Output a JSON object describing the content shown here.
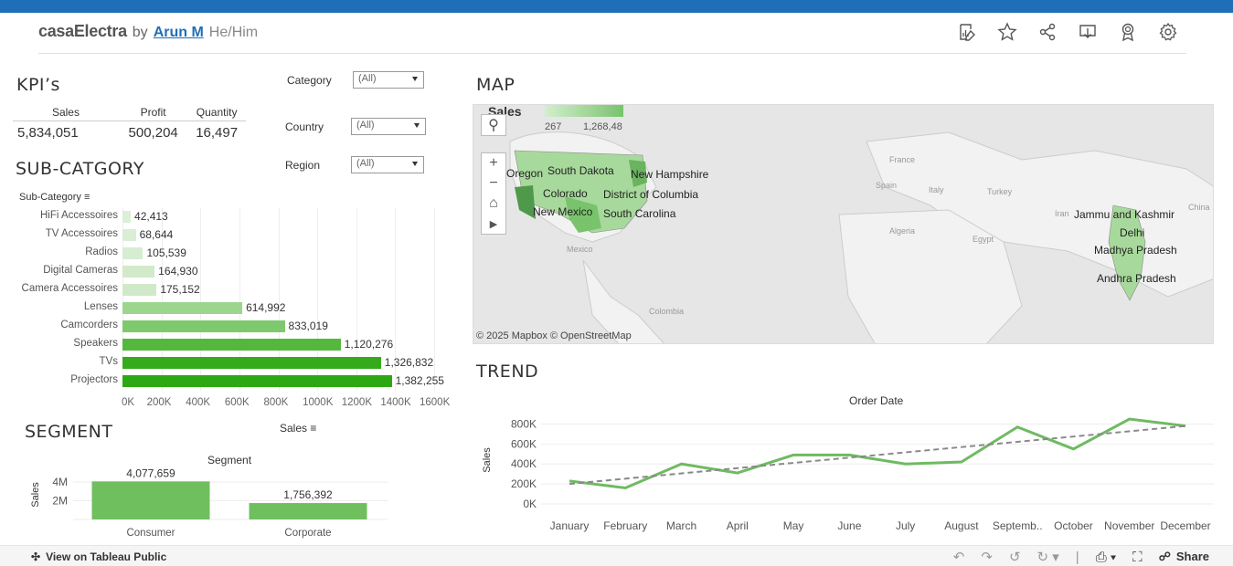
{
  "header": {
    "brand": "casaElectra",
    "by": "by",
    "author": "Arun M",
    "pronouns": "He/Him",
    "icons": [
      "edit-icon",
      "star-icon",
      "share-icon",
      "download-icon",
      "award-icon",
      "settings-icon"
    ]
  },
  "kpi": {
    "title": "KPI’s",
    "headers": [
      "Sales",
      "Profit",
      "Quantity"
    ],
    "values": [
      "5,834,051",
      "500,204",
      "16,497"
    ]
  },
  "filters": [
    {
      "label": "Category",
      "value": "(All)"
    },
    {
      "label": "Country",
      "value": "(All)"
    },
    {
      "label": "Region",
      "value": "(All)"
    }
  ],
  "subcategory": {
    "title": "SUB-CATGORY",
    "header": "Sub-Category"
  },
  "map": {
    "title": "MAP",
    "legend_title": "Sales",
    "legend_lo": "267",
    "legend_hi": "1,268,48",
    "labels": [
      "Oregon",
      "South Dakota",
      "New Hampshire",
      "Colorado",
      "District of Columbia",
      "New Mexico",
      "South Carolina",
      "Jammu and Kashmir",
      "Delhi",
      "Madhya Pradesh",
      "Andhra Pradesh"
    ],
    "faint_labels": [
      "France",
      "Spain",
      "Italy",
      "Turkey",
      "Iran",
      "China",
      "Algeria",
      "Egypt",
      "Mexico",
      "Colombia"
    ],
    "attribution": "© 2025 Mapbox  © OpenStreetMap",
    "colors": {
      "low": "#d4eecd",
      "high": "#4f9a4a"
    }
  },
  "segment": {
    "title": "SEGMENT",
    "sort_label": "Sales",
    "axis_title": "Segment"
  },
  "trend": {
    "title": "TREND",
    "axis_title": "Order Date"
  },
  "bottombar": {
    "view_label": "View on Tableau Public",
    "share_label": "Share"
  },
  "chart_data": [
    {
      "type": "bar",
      "orientation": "horizontal",
      "categories": [
        "HiFi Accessoires",
        "TV Accessoires",
        "Radios",
        "Digital Cameras",
        "Camera Accessoires",
        "Lenses",
        "Camcorders",
        "Speakers",
        "TVs",
        "Projectors"
      ],
      "values": [
        42413,
        68644,
        105539,
        164930,
        175152,
        614992,
        833019,
        1120276,
        1326832,
        1382255
      ],
      "value_labels": [
        "42,413",
        "68,644",
        "105,539",
        "164,930",
        "175,152",
        "614,992",
        "833,019",
        "1,120,276",
        "1,326,832",
        "1,382,255"
      ],
      "xticks": [
        "0K",
        "200K",
        "400K",
        "600K",
        "800K",
        "1000K",
        "1200K",
        "1400K",
        "1600K"
      ],
      "xlim": [
        0,
        1600000
      ],
      "colors": {
        "low": "#dff0da",
        "high": "#2ca812"
      }
    },
    {
      "type": "bar",
      "categories": [
        "Consumer",
        "Corporate"
      ],
      "values": [
        4077659,
        1756392
      ],
      "value_labels": [
        "4,077,659",
        "1,756,392"
      ],
      "title": "Segment",
      "ylabel": "Sales",
      "yticks": [
        "2M",
        "4M"
      ],
      "ylim": [
        0,
        4500000
      ],
      "color": "#70bf5f"
    },
    {
      "type": "line",
      "title": "Order Date",
      "ylabel": "Sales",
      "x": [
        "January",
        "February",
        "March",
        "April",
        "May",
        "June",
        "July",
        "August",
        "Septemb..",
        "October",
        "November",
        "December"
      ],
      "values": [
        230000,
        160000,
        400000,
        310000,
        490000,
        490000,
        400000,
        420000,
        770000,
        550000,
        850000,
        780000
      ],
      "trend_line": [
        200000,
        780000
      ],
      "yticks": [
        "0K",
        "200K",
        "400K",
        "600K",
        "800K"
      ],
      "ylim": [
        0,
        850000
      ],
      "color": "#6fba62",
      "trend_color": "#888888"
    }
  ]
}
